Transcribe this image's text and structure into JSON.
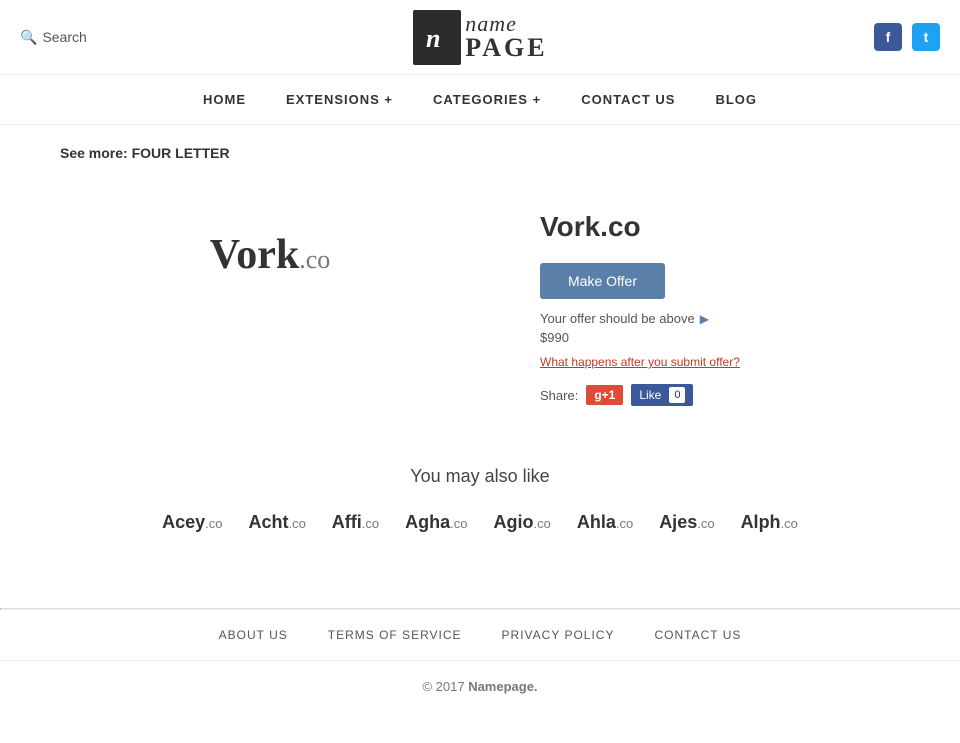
{
  "header": {
    "search_label": "Search",
    "logo_icon_char": "n",
    "logo_name": "name",
    "logo_page": "PAGE",
    "social_facebook_label": "f",
    "social_twitter_label": "t"
  },
  "nav": {
    "items": [
      {
        "label": "HOME",
        "has_dropdown": false
      },
      {
        "label": "EXTENSIONS +",
        "has_dropdown": true
      },
      {
        "label": "CATEGORIES +",
        "has_dropdown": true
      },
      {
        "label": "CONTACT US",
        "has_dropdown": false
      },
      {
        "label": "BLOG",
        "has_dropdown": false
      }
    ]
  },
  "see_more": {
    "prefix": "See more:",
    "link_text": "FOUR LETTER"
  },
  "domain": {
    "name": "Vork",
    "tld": ".co",
    "full": "Vork.co",
    "make_offer_label": "Make Offer",
    "offer_hint": "Your offer should be above",
    "offer_price": "$990",
    "what_happens": "What happens after you submit offer?",
    "share_label": "Share:",
    "gplus_label": "g+1",
    "fb_like_label": "Like",
    "fb_count": "0"
  },
  "also_like": {
    "title": "You may also like",
    "items": [
      {
        "name": "Acey",
        "tld": ".co"
      },
      {
        "name": "Acht",
        "tld": ".co"
      },
      {
        "name": "Affi",
        "tld": ".co"
      },
      {
        "name": "Agha",
        "tld": ".co"
      },
      {
        "name": "Agio",
        "tld": ".co"
      },
      {
        "name": "Ahla",
        "tld": ".co"
      },
      {
        "name": "Ajes",
        "tld": ".co"
      },
      {
        "name": "Alph",
        "tld": ".co"
      }
    ]
  },
  "footer": {
    "nav_items": [
      {
        "label": "ABOUT US"
      },
      {
        "label": "TERMS OF SERVICE"
      },
      {
        "label": "PRIVACY POLICY"
      },
      {
        "label": "CONTACT US"
      }
    ],
    "copy": "© 2017",
    "brand": "Namepage."
  }
}
